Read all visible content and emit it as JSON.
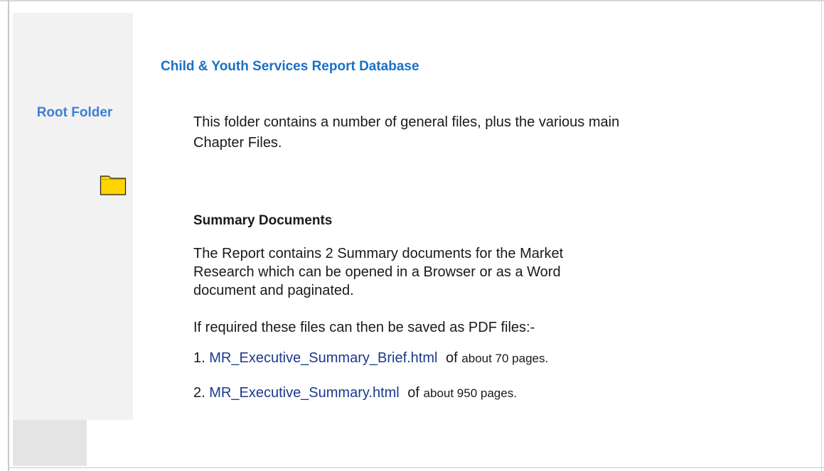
{
  "sidebar": {
    "title": "Root Folder",
    "folder_icon": "folder-icon",
    "folder_color": "#ffd500"
  },
  "main": {
    "title": "Child & Youth Services Report Database",
    "intro": "This folder contains a number of general files, plus the various main Chapter Files.",
    "section_heading": "Summary Documents",
    "para1": "The Report contains 2 Summary documents for the Market Research which can be opened in a Browser or as a Word document and paginated.",
    "para2": "If required these files can then be saved as PDF files:-",
    "files": [
      {
        "number": "1.",
        "name": "MR_Executive_Summary_Brief.html",
        "of": "of",
        "suffix": "about 70 pages."
      },
      {
        "number": "2.",
        "name": "MR_Executive_Summary.html",
        "of": "of",
        "suffix": "about 950 pages."
      }
    ]
  },
  "colors": {
    "title_blue": "#1a6fc6",
    "sidebar_title_blue": "#3e7fd4",
    "link_navy": "#1a3a8a"
  }
}
